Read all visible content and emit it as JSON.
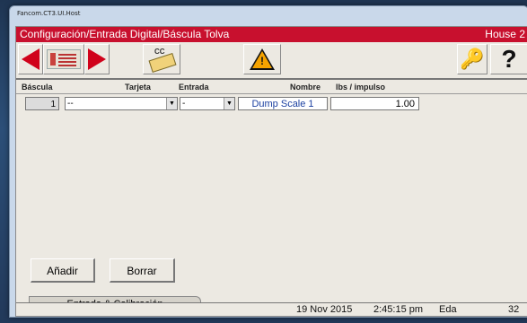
{
  "window": {
    "os_title": "Fancom.CT3.UI.Host"
  },
  "titlebar": {
    "title": "Configuración/Entrada Digital/Báscula Tolva",
    "house": "House 2"
  },
  "toolbar": {
    "cc_label": "CC",
    "warning_mark": "!",
    "help_label": "?"
  },
  "table": {
    "headers": {
      "bascula": "Báscula",
      "tarjeta": "Tarjeta",
      "entrada": "Entrada",
      "nombre": "Nombre",
      "lbs": "lbs / impulso"
    },
    "rows": [
      {
        "num": "1",
        "tarjeta": "--",
        "entrada": "-",
        "nombre": "Dump Scale 1",
        "lbs": "1.00"
      }
    ]
  },
  "buttons": {
    "add": "Añadir",
    "delete": "Borrar"
  },
  "tabs": [
    {
      "label": "Entrada & Calibración"
    }
  ],
  "status": {
    "date": "19 Nov 2015",
    "time": "2:45:15 pm",
    "user": "Eda",
    "value": "32"
  },
  "colors": {
    "title_bg": "#c8102e",
    "arrow": "#d0021b",
    "warning": "#f5a300"
  }
}
